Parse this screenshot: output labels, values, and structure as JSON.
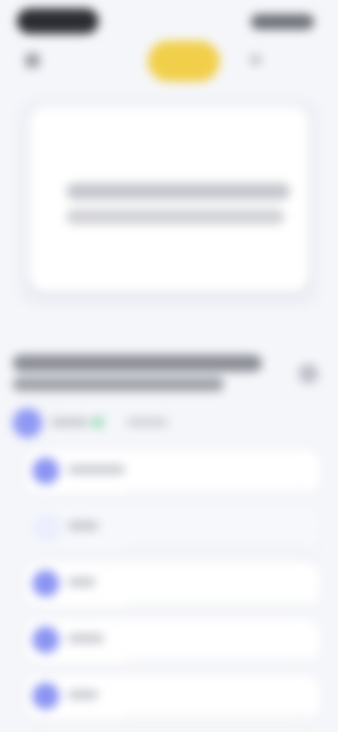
{
  "list": {
    "items": [
      {
        "text_width": 82
      },
      {
        "text_width": 44
      },
      {
        "text_width": 40
      },
      {
        "text_width": 52
      },
      {
        "text_width": 44
      }
    ]
  }
}
